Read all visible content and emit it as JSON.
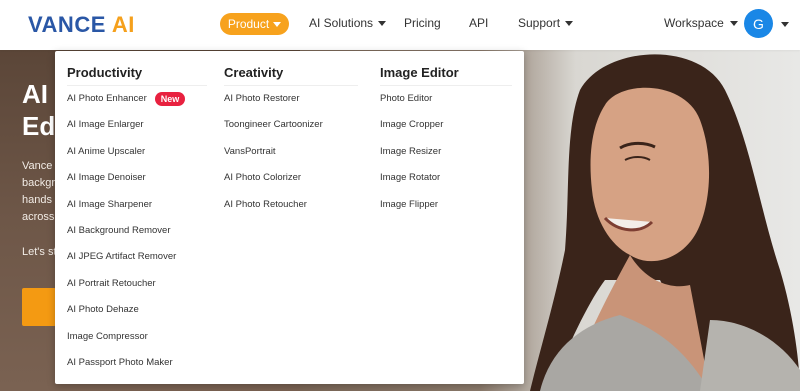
{
  "brand": {
    "part1": "VANCE",
    "part2": "AI",
    "colors": {
      "blue": "#2a57a6",
      "orange": "#f5a01c"
    }
  },
  "nav": {
    "product": "Product",
    "ai_solutions": "AI Solutions",
    "pricing": "Pricing",
    "api": "API",
    "support": "Support",
    "workspace": "Workspace",
    "avatar_letter": "G",
    "accent_color": "#f7a21d"
  },
  "hero": {
    "title_line1": "AI",
    "title_line2": "Ed",
    "desc_lines": [
      "Vance",
      "backgr",
      "hands",
      "across"
    ],
    "cta_text": "Let's st"
  },
  "dropdown": {
    "columns": [
      {
        "heading": "Productivity",
        "items": [
          {
            "label": "AI Photo Enhancer",
            "badge": "New"
          },
          {
            "label": "AI Image Enlarger"
          },
          {
            "label": "AI Anime Upscaler"
          },
          {
            "label": "AI Image Denoiser"
          },
          {
            "label": "AI Image Sharpener"
          },
          {
            "label": "AI Background Remover"
          },
          {
            "label": "AI JPEG Artifact Remover"
          },
          {
            "label": "AI Portrait Retoucher"
          },
          {
            "label": "AI Photo Dehaze"
          },
          {
            "label": "Image Compressor"
          },
          {
            "label": "AI Passport Photo Maker"
          }
        ]
      },
      {
        "heading": "Creativity",
        "items": [
          {
            "label": "AI Photo Restorer"
          },
          {
            "label": "Toongineer Cartoonizer"
          },
          {
            "label": "VansPortrait"
          },
          {
            "label": "AI Photo Colorizer"
          },
          {
            "label": "AI Photo Retoucher"
          }
        ]
      },
      {
        "heading": "Image Editor",
        "items": [
          {
            "label": "Photo Editor"
          },
          {
            "label": "Image Cropper"
          },
          {
            "label": "Image Resizer"
          },
          {
            "label": "Image Rotator"
          },
          {
            "label": "Image Flipper"
          }
        ]
      }
    ]
  }
}
